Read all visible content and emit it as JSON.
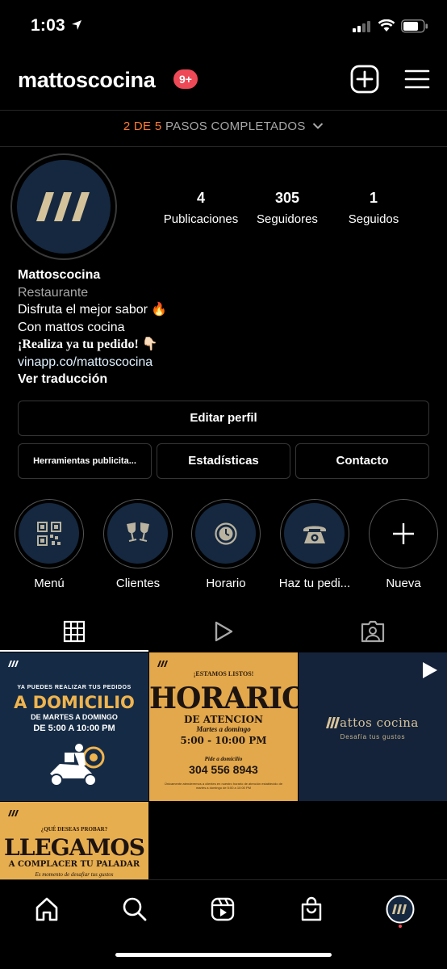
{
  "status_bar": {
    "time": "1:03"
  },
  "header": {
    "username": "mattoscocina",
    "notification_badge": "9+"
  },
  "steps": {
    "progress": "2 DE 5",
    "label": "PASOS COMPLETADOS"
  },
  "profile": {
    "stats": [
      {
        "value": "4",
        "label": "Publicaciones"
      },
      {
        "value": "305",
        "label": "Seguidores"
      },
      {
        "value": "1",
        "label": "Seguidos"
      }
    ],
    "name": "Mattoscocina",
    "category": "Restaurante",
    "bio_line1": "Disfruta el mejor sabor 🔥",
    "bio_line2": "Con mattos cocina",
    "bio_line3": "¡Realiza ya tu pedido! 👇🏻",
    "link": "vinapp.co/mattoscocina",
    "translate": "Ver traducción"
  },
  "buttons": {
    "edit": "Editar perfil",
    "tools": "Herramientas publicita...",
    "stats": "Estadísticas",
    "contact": "Contacto"
  },
  "highlights": [
    {
      "label": "Menú",
      "icon": "qr-code-icon"
    },
    {
      "label": "Clientes",
      "icon": "toast-glasses-icon"
    },
    {
      "label": "Horario",
      "icon": "clock-icon"
    },
    {
      "label": "Haz tu pedi...",
      "icon": "phone-icon"
    },
    {
      "label": "Nueva",
      "icon": "plus-icon"
    }
  ],
  "posts": {
    "p1": {
      "line1": "YA PUEDES REALIZAR TUS PEDIDOS",
      "line2": "A DOMICILIO",
      "line3": "DE MARTES A DOMINGO",
      "line4": "DE 5:00 A 10:00 PM"
    },
    "p2": {
      "line1": "¡ESTAMOS LISTOS!",
      "line2": "HORARIO",
      "line3": "DE ATENCION",
      "line4": "Martes a domingo",
      "line5": "5:00 - 10:00 PM",
      "line6": "Pide a domicilio",
      "line7": "304 556 8943",
      "line8": "Únicamente atenderemos a clientes en nuestro horario de atención establecido de martes a domingo de 5:00 a 10:00 PM"
    },
    "p3": {
      "line1": "attos cocina",
      "line2": "Desafía tus gustos"
    },
    "p4": {
      "line1": "¿QUÉ DESEAS PROBAR?",
      "line2": "LLEGAMOS",
      "line3": "A COMPLACER TU PALADAR",
      "line4": "Es momento de desafiar tus gustos"
    }
  },
  "colors": {
    "accent_orange": "#ff7a2e",
    "badge_red": "#ed4956",
    "brand_navy": "#15283f",
    "brand_gold": "#e3a84b"
  }
}
